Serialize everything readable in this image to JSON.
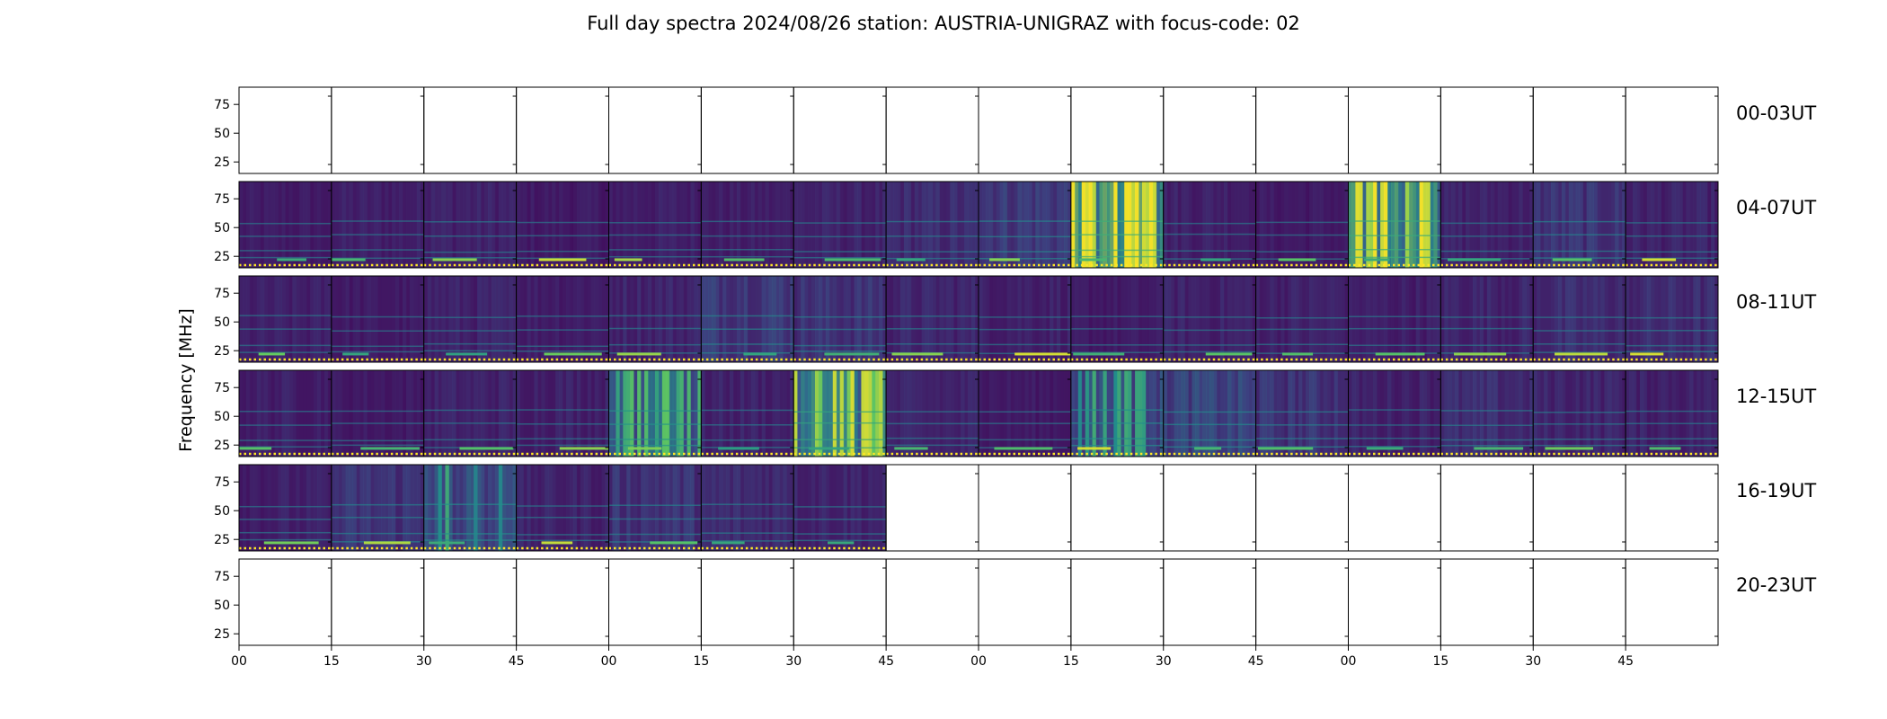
{
  "chart_data": {
    "type": "heatmap",
    "title": "Full day spectra 2024/08/26 station: AUSTRIA-UNIGRAZ with focus-code: 02",
    "ylabel": "Frequency [MHz]",
    "xlabel": "",
    "ylim": [
      15,
      90
    ],
    "yticks": [
      "25",
      "50",
      "75"
    ],
    "ytick_values": [
      25,
      50,
      75
    ],
    "xticks": [
      "00",
      "15",
      "30",
      "45",
      "00",
      "15",
      "30",
      "45",
      "00",
      "15",
      "30",
      "45",
      "00",
      "15",
      "30",
      "45"
    ],
    "rows": [
      {
        "label": "00-03UT",
        "has_data": [
          0,
          0,
          0,
          0,
          0,
          0,
          0,
          0,
          0,
          0,
          0,
          0,
          0,
          0,
          0,
          0
        ],
        "intensity": [
          0,
          0,
          0,
          0,
          0,
          0,
          0,
          0,
          0,
          0,
          0,
          0,
          0,
          0,
          0,
          0
        ]
      },
      {
        "label": "04-07UT",
        "has_data": [
          1,
          1,
          1,
          1,
          1,
          1,
          1,
          1,
          1,
          1,
          1,
          1,
          1,
          1,
          1,
          1
        ],
        "intensity": [
          0.15,
          0.18,
          0.2,
          0.15,
          0.18,
          0.17,
          0.2,
          0.25,
          0.35,
          0.9,
          0.2,
          0.15,
          0.85,
          0.2,
          0.3,
          0.2
        ]
      },
      {
        "label": "08-11UT",
        "has_data": [
          1,
          1,
          1,
          1,
          1,
          1,
          1,
          1,
          1,
          1,
          1,
          1,
          1,
          1,
          1,
          1
        ],
        "intensity": [
          0.18,
          0.15,
          0.2,
          0.18,
          0.22,
          0.35,
          0.3,
          0.22,
          0.2,
          0.15,
          0.2,
          0.2,
          0.18,
          0.22,
          0.25,
          0.25
        ]
      },
      {
        "label": "12-15UT",
        "has_data": [
          1,
          1,
          1,
          1,
          1,
          1,
          1,
          1,
          1,
          1,
          1,
          1,
          1,
          1,
          1,
          1
        ],
        "intensity": [
          0.18,
          0.15,
          0.2,
          0.2,
          0.55,
          0.2,
          0.75,
          0.2,
          0.15,
          0.45,
          0.4,
          0.3,
          0.2,
          0.25,
          0.22,
          0.2
        ]
      },
      {
        "label": "16-19UT",
        "has_data": [
          1,
          1,
          1,
          1,
          1,
          1,
          1,
          0,
          0,
          0,
          0,
          0,
          0,
          0,
          0,
          0
        ],
        "intensity": [
          0.18,
          0.3,
          0.45,
          0.2,
          0.3,
          0.25,
          0.22,
          0,
          0,
          0,
          0,
          0,
          0,
          0,
          0,
          0
        ]
      },
      {
        "label": "20-23UT",
        "has_data": [
          0,
          0,
          0,
          0,
          0,
          0,
          0,
          0,
          0,
          0,
          0,
          0,
          0,
          0,
          0,
          0
        ],
        "intensity": [
          0,
          0,
          0,
          0,
          0,
          0,
          0,
          0,
          0,
          0,
          0,
          0,
          0,
          0,
          0,
          0
        ]
      }
    ],
    "colormap": [
      "#440154",
      "#3b528b",
      "#21918c",
      "#5ec962",
      "#fde725"
    ],
    "grid": false,
    "legend": "none"
  }
}
